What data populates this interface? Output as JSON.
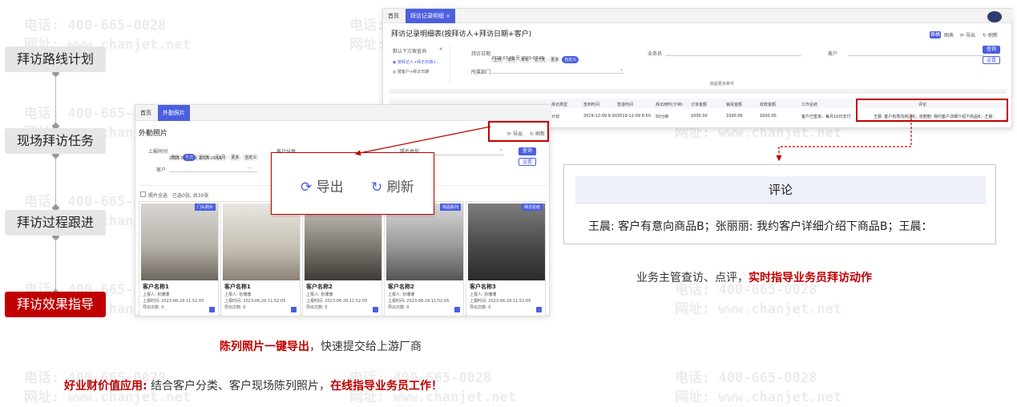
{
  "watermark": {
    "phone": "电话: 400-665-0028",
    "site": "网址: www.chanjet.net"
  },
  "steps": [
    {
      "label": "拜访路线计划"
    },
    {
      "label": "现场拜访任务"
    },
    {
      "label": "拜访过程跟进"
    },
    {
      "label": "拜访效果指导"
    }
  ],
  "report_window": {
    "tabs": [
      "首页",
      "拜访记录明细 ×"
    ],
    "title": "拜访记录明细表(按拜访人+拜访日期+客户)",
    "toolbar": {
      "tag": "表格",
      "chart": "图表",
      "export": "导出",
      "refresh": "刷新"
    },
    "left_panel": {
      "header": "默认下方案查询",
      "options": [
        "按拜访人+拜访日期+...",
        "按客户+拜访日期"
      ]
    },
    "filters": {
      "date_label": "拜访日期",
      "date_chips": [
        "上月",
        "本月",
        "本年",
        "近7天",
        "更多",
        "自定义"
      ],
      "date_range": "2019-07-05 至 2023-07-05",
      "salesman_label": "业务员",
      "customer_label": "客户",
      "dept_label": "所属部门",
      "query": "查询",
      "reset": "设置",
      "more": "收起更多条件"
    },
    "columns": [
      "拜访类型",
      "签到时间",
      "签退时间",
      "拜访用时(分钟)",
      "订单金额",
      "销货金额",
      "收款金额",
      "工作总结",
      "评论"
    ],
    "row": [
      "计划",
      "2019-12-09 9:00",
      "2019-12-09 9:50",
      "50分钟",
      "1000.00",
      "1000.00",
      "1000.00",
      "客户已签单，每月10日支付",
      "王晨: 客户有意向商品B；张丽丽: 我约客户详细介绍下商品B；王晨："
    ]
  },
  "photo_window": {
    "tabs": [
      "首页",
      "外勤照片"
    ],
    "title": "外勤照片",
    "export": "导出",
    "refresh": "刷新",
    "filters": {
      "time_label": "上报时间",
      "time_chips": [
        "昨天",
        "今天",
        "近7天",
        "近1月",
        "更多",
        "自定义"
      ],
      "time_range": "2023-05-01 至 2023-05-01",
      "customer_class": "客户分类",
      "photo_type": "照片类型",
      "customer": "客户",
      "query": "查询",
      "reset": "设置"
    },
    "select_all": "照片全选",
    "selected_info": "已选0张, 共30张",
    "photos": [
      {
        "name": "客户名称1",
        "tag": "门头照片",
        "reporter": "上报人: 张珊珊",
        "time": "上报时间: 2023-06-29 11:52:05",
        "count": "导出次数: 0"
      },
      {
        "name": "客户名称1",
        "tag": "",
        "reporter": "上报人: 张珊珊",
        "time": "上报时间: 2023-06-29 11:52:05",
        "count": "导出次数: 0"
      },
      {
        "name": "客户名称2",
        "tag": "",
        "reporter": "上报人: 张珊珊",
        "time": "上报时间: 2023-06-29 11:52:05",
        "count": "导出次数: 0"
      },
      {
        "name": "客户名称2",
        "tag": "商品陈列",
        "reporter": "上报人: 张珊珊",
        "time": "上报时间: 2023-06-29 11:52:05",
        "count": "导出次数: 0"
      },
      {
        "name": "客户名称3",
        "tag": "拜访总结",
        "reporter": "上报人: 张珊珊",
        "time": "上报时间: 2023-06-29 11:52:05",
        "count": "导出次数: 0"
      }
    ]
  },
  "zoom_export": {
    "export": "导出",
    "refresh": "刷新"
  },
  "comment_zoom": {
    "header": "评论",
    "text": "王晨: 客户有意向商品B；张丽丽: 我约客户详细介绍下商品B；王晨："
  },
  "captions": {
    "right_a": "业务主管查访、点评，",
    "right_b": "实时指导业务员拜访动作",
    "left_a": "陈列照片一键导出",
    "left_b": "，快速提交给上游厂商",
    "bottom_a": "好业财价值应用:",
    "bottom_b": " 结合客户分类、客户现场陈列照片，",
    "bottom_c": "在线指导业务员工作！"
  },
  "colors": {
    "accent": "#4b5fe0",
    "highlight": "#c00000"
  }
}
